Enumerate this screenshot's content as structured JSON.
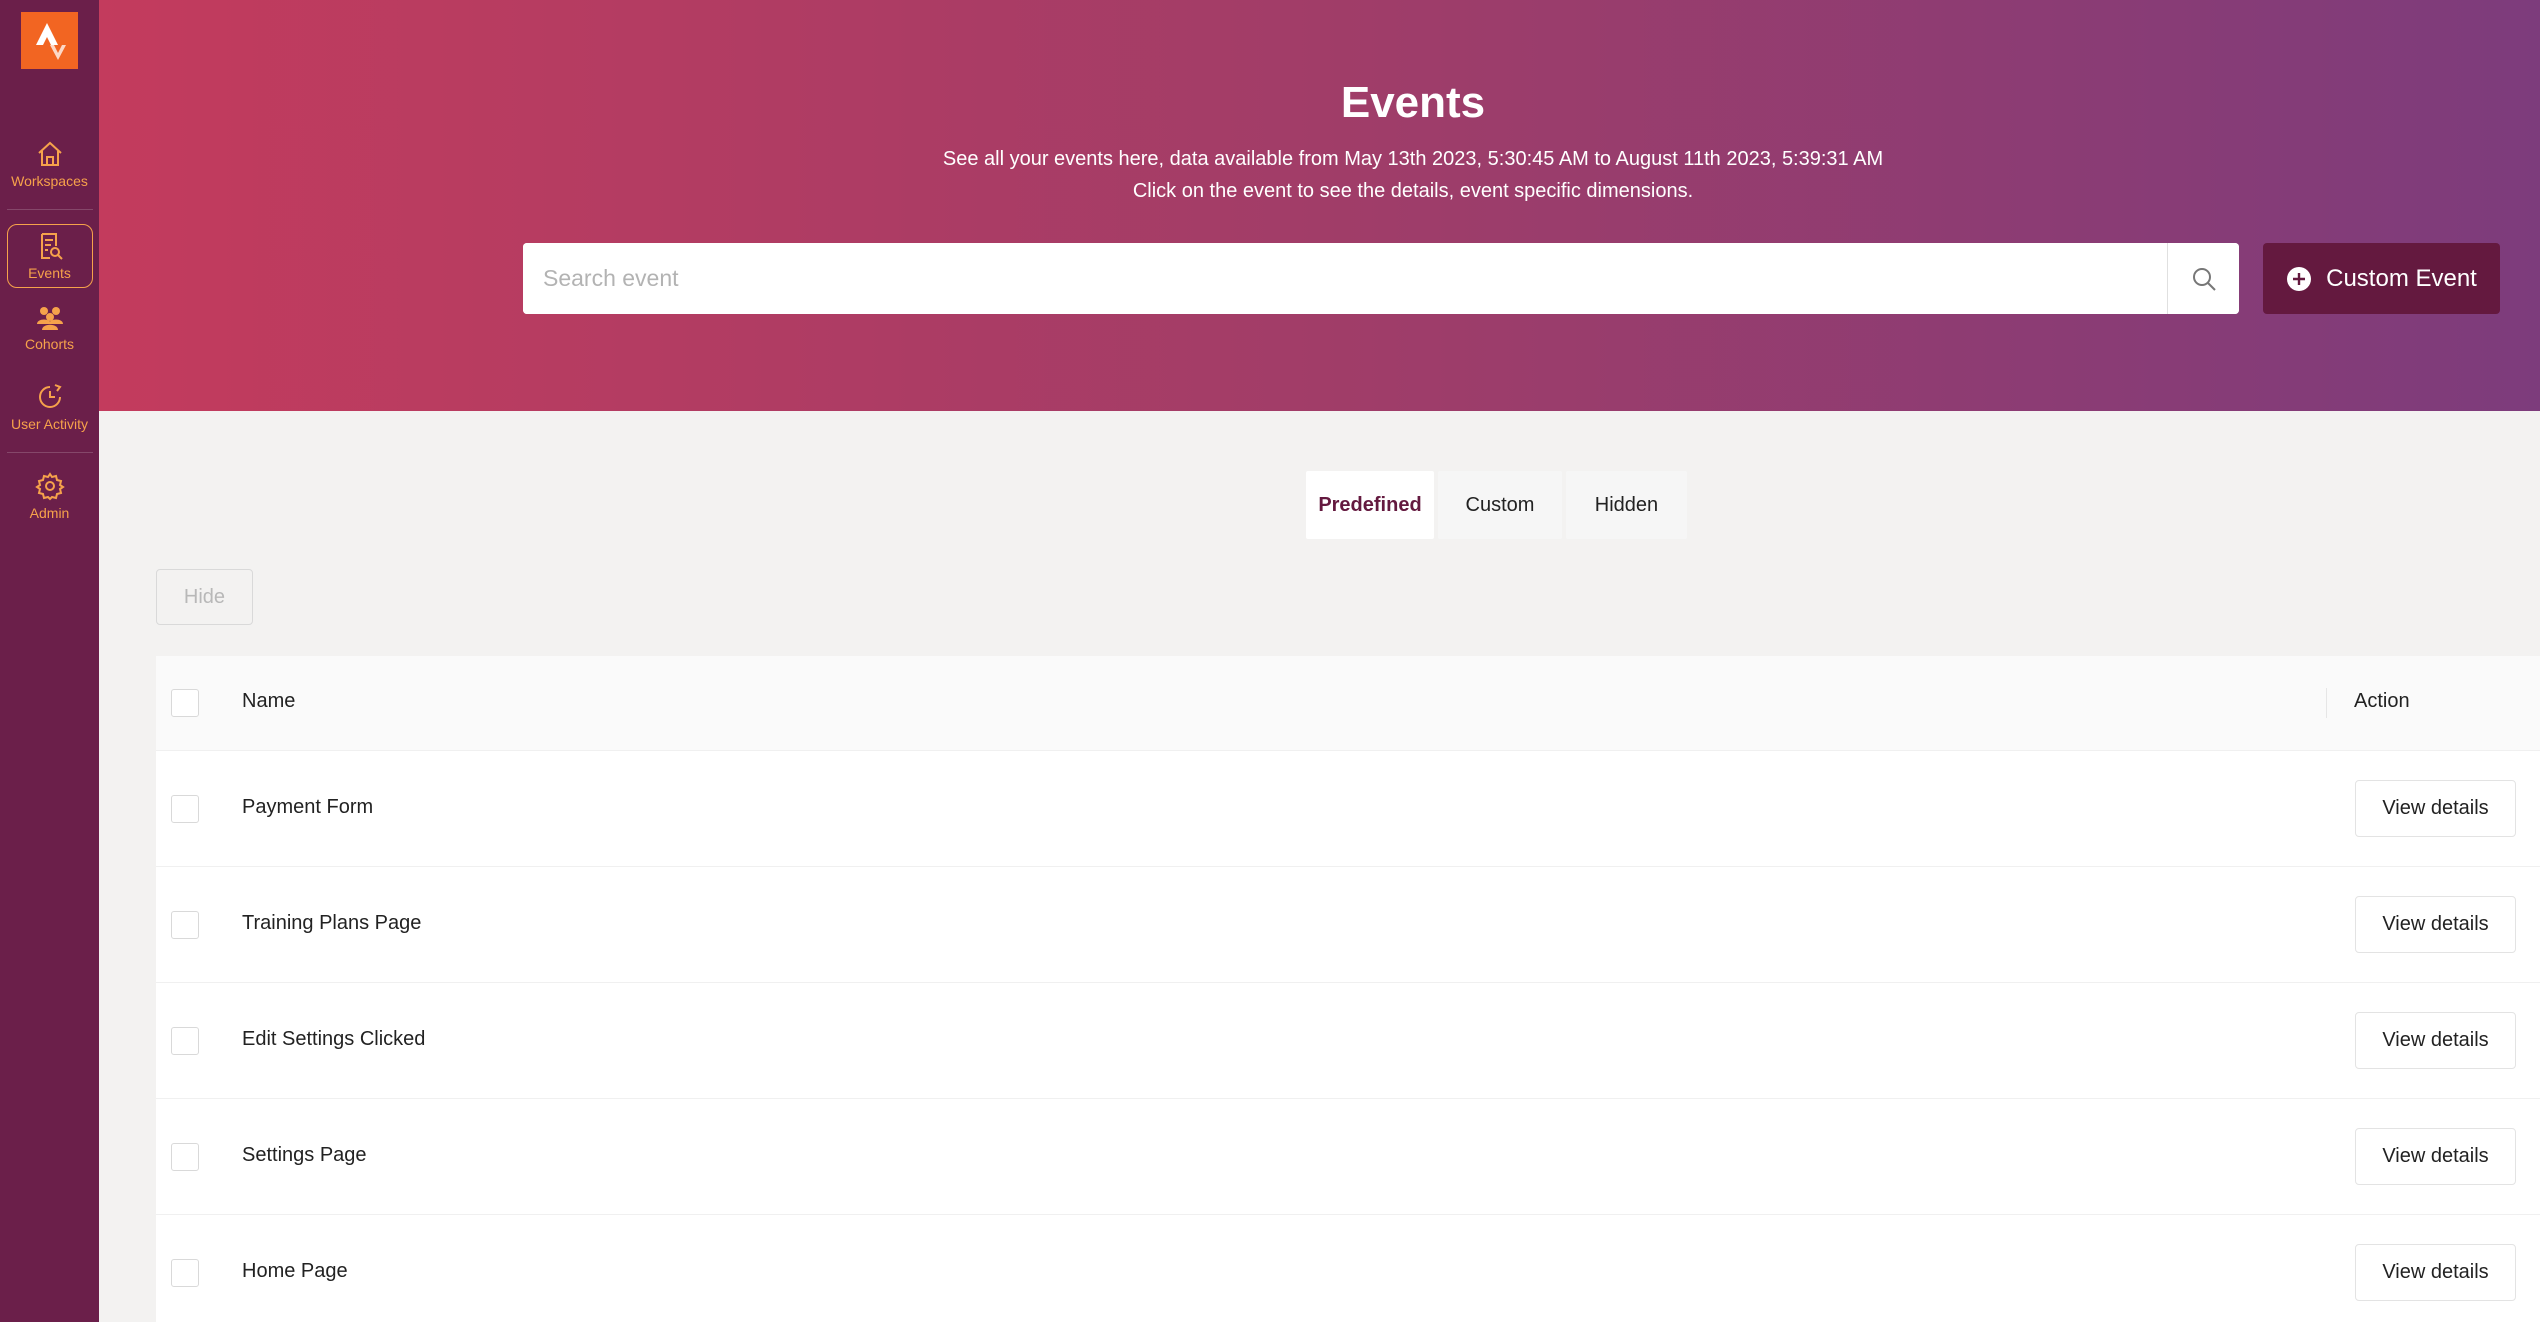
{
  "sidebar": {
    "logo_icon": "strava-logo-icon",
    "items": [
      {
        "label": "Workspaces",
        "icon": "home-icon"
      },
      {
        "label": "Events",
        "icon": "events-icon",
        "active": true
      },
      {
        "label": "Cohorts",
        "icon": "users-icon"
      },
      {
        "label": "User Activity",
        "icon": "activity-icon"
      },
      {
        "label": "Admin",
        "icon": "gear-icon"
      }
    ]
  },
  "header": {
    "title": "Events",
    "subtitle_line1": "See all your events here, data available from  May 13th 2023, 5:30:45 AM  to  August 11th 2023, 5:39:31 AM",
    "subtitle_line2": "Click on the event to see the details, event specific dimensions."
  },
  "search": {
    "placeholder": "Search event",
    "value": ""
  },
  "custom_event_button": "Custom Event",
  "tabs": [
    {
      "label": "Predefined",
      "active": true
    },
    {
      "label": "Custom",
      "active": false
    },
    {
      "label": "Hidden",
      "active": false
    }
  ],
  "hide_button": "Hide",
  "table": {
    "columns": [
      "Name",
      "Action"
    ],
    "rows": [
      {
        "name": "Payment Form",
        "action": "View details"
      },
      {
        "name": "Training Plans Page",
        "action": "View details"
      },
      {
        "name": "Edit Settings Clicked",
        "action": "View details"
      },
      {
        "name": "Settings Page",
        "action": "View details"
      },
      {
        "name": "Home Page",
        "action": "View details"
      }
    ]
  },
  "colors": {
    "sidebar_bg": "#6b1f4a",
    "accent_orange": "#f6a24b",
    "logo_bg": "#f26522",
    "hero_gradient_start": "#c33b5d",
    "hero_gradient_end": "#7d3c7c",
    "primary_button": "#64193f"
  }
}
